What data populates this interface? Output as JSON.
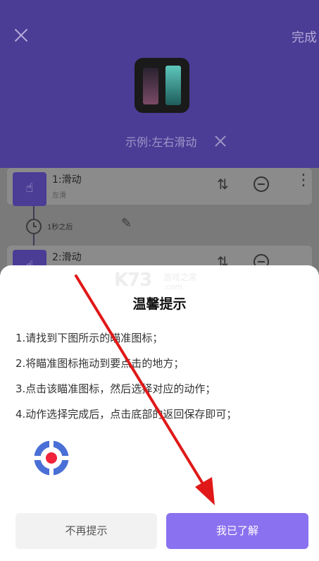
{
  "header": {
    "done_label": "完成",
    "example_label": "示例:左右滑动"
  },
  "list": {
    "steps": [
      {
        "title": "1:滑动",
        "subtitle": "左滑"
      },
      {
        "title": "2:滑动",
        "subtitle": ""
      }
    ],
    "delay_label": "1秒之后"
  },
  "dialog": {
    "watermark": {
      "logo": "K73",
      "site_cn": "游戏之家",
      "site_com": ".com"
    },
    "title": "温馨提示",
    "tips": [
      "1.请找到下图所示的瞄准图标；",
      "2.将瞄准图标拖动到要点击的地方；",
      "3.点击该瞄准图标，然后选择对应的动作；",
      "4.动作选择完成后，点击底部的返回保存即可；"
    ],
    "dismiss_label": "不再提示",
    "ok_label": "我已了解"
  },
  "colors": {
    "header_bg": "#4b3c95",
    "accent": "#8a71ef",
    "target_blue": "#4a6fd6",
    "target_red": "#f0233b",
    "arrow_red": "#e01818"
  },
  "icons": [
    "close-icon",
    "app-logo-icon",
    "swipe-gesture-icon",
    "sort-icon",
    "remove-icon",
    "more-icon",
    "clock-icon",
    "pencil-icon",
    "crosshair-target-icon"
  ]
}
